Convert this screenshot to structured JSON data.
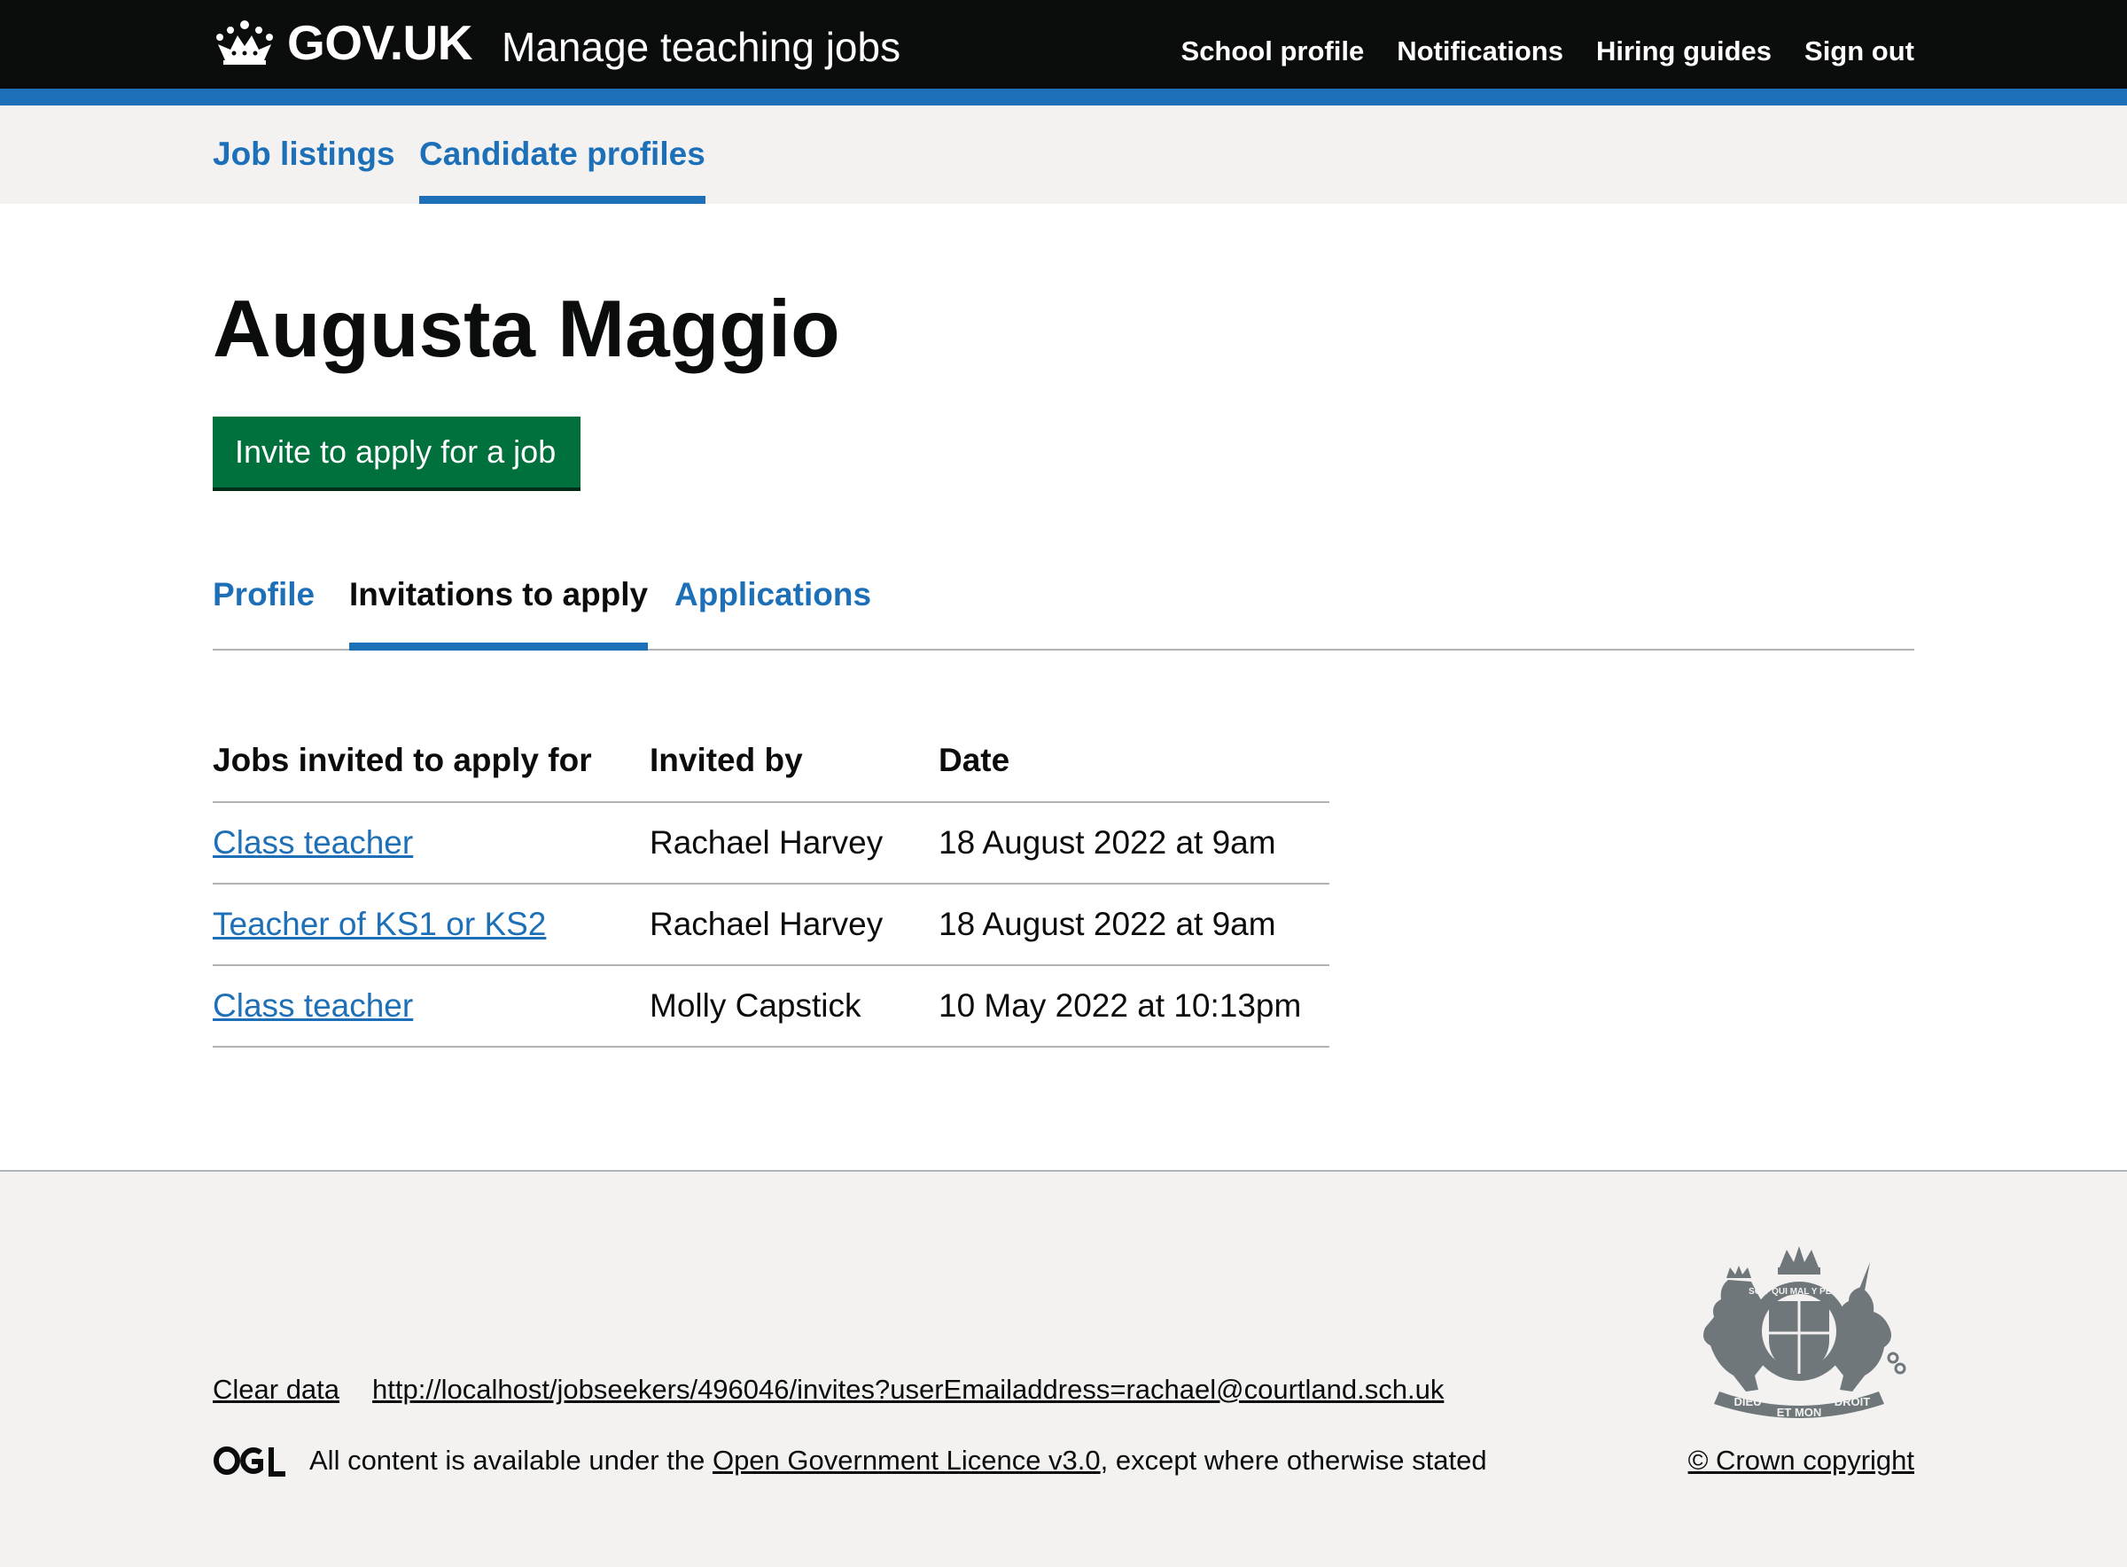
{
  "header": {
    "logo_text": "GOV.UK",
    "service_name": "Manage teaching jobs",
    "nav": [
      "School profile",
      "Notifications",
      "Hiring guides",
      "Sign out"
    ]
  },
  "subnav": {
    "items": [
      "Job listings",
      "Candidate profiles"
    ],
    "active": "Candidate profiles"
  },
  "main": {
    "title": "Augusta Maggio",
    "invite_button": "Invite to apply for a job",
    "tabs": [
      "Profile",
      "Invitations to apply",
      "Applications"
    ],
    "active_tab": "Invitations to apply",
    "table": {
      "headers": [
        "Jobs invited to apply for",
        "Invited by",
        "Date"
      ],
      "rows": [
        {
          "job": "Class teacher",
          "invited_by": "Rachael Harvey",
          "date": "18 August 2022 at 9am"
        },
        {
          "job": "Teacher of KS1 or KS2",
          "invited_by": "Rachael Harvey",
          "date": "18 August 2022 at 9am"
        },
        {
          "job": "Class teacher",
          "invited_by": "Molly Capstick",
          "date": "10 May 2022 at 10:13pm"
        }
      ]
    }
  },
  "footer": {
    "clear_data": "Clear data",
    "url": "http://localhost/jobseekers/496046/invites?userEmailaddress=rachael@courtland.sch.uk",
    "ogl_logo": "OGL",
    "licence_prefix": "All content is available under the ",
    "licence_link": "Open Government Licence v3.0",
    "licence_suffix": ", except where otherwise stated",
    "crest_text": [
      "DIEU",
      "ET MON",
      "DROIT",
      "SOIT QUI MAL Y PENSE"
    ],
    "copyright": "© Crown copyright"
  },
  "colors": {
    "header_bg": "#0b0c0c",
    "brand_blue": "#1d70b8",
    "button_green": "#00703c",
    "footer_bg": "#f3f2f1",
    "border": "#b1b4b6"
  }
}
